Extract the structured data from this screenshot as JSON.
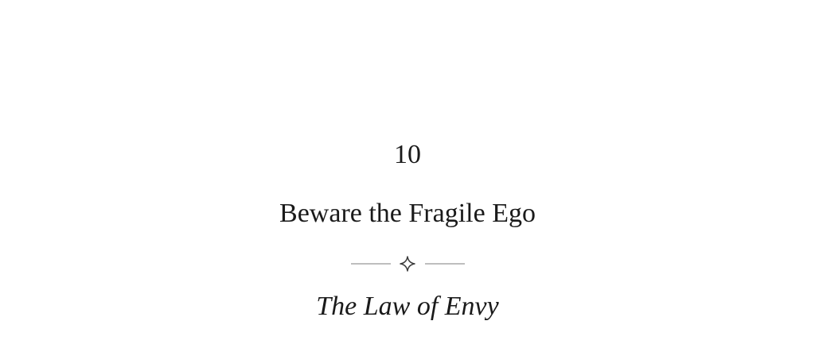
{
  "chapter": {
    "number": "10",
    "title": "Beware the Fragile Ego",
    "subtitle": "The Law of Envy"
  },
  "ornament": {
    "icon": "four-point-star-icon",
    "line_color": "#a8a8a8",
    "star_color": "#3a3a3a"
  }
}
